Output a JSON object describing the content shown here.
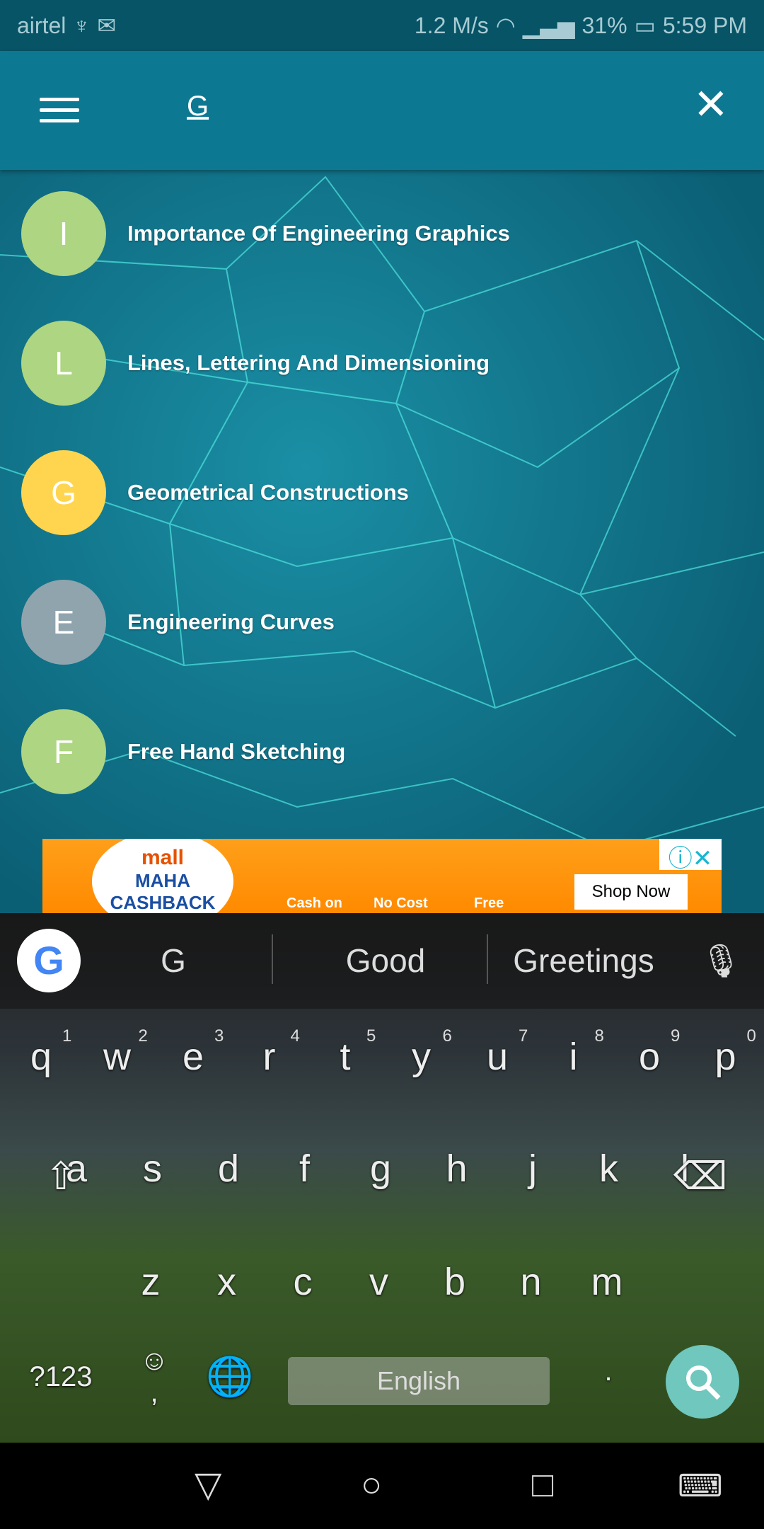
{
  "status": {
    "carrier": "airtel",
    "speed": "1.2 M/s",
    "battery": "31%",
    "time": "5:59 PM"
  },
  "search": {
    "query": "G"
  },
  "results": [
    {
      "letter": "I",
      "title": "Importance Of Engineering Graphics",
      "color": "#aed581"
    },
    {
      "letter": "L",
      "title": "Lines, Lettering And Dimensioning",
      "color": "#aed581"
    },
    {
      "letter": "G",
      "title": "Geometrical Constructions",
      "color": "#ffd54f"
    },
    {
      "letter": "E",
      "title": "Engineering Curves",
      "color": "#90a4ae"
    },
    {
      "letter": "F",
      "title": "Free Hand Sketching",
      "color": "#aed581"
    }
  ],
  "ad": {
    "brand": "mall",
    "headline": "MAHA CASHBACK",
    "features": [
      "Cash on",
      "No Cost",
      "Free"
    ],
    "cta": "Shop Now"
  },
  "keyboard": {
    "suggestions": [
      "G",
      "Good",
      "Greetings"
    ],
    "rows": [
      [
        "q",
        "w",
        "e",
        "r",
        "t",
        "y",
        "u",
        "i",
        "o",
        "p"
      ],
      [
        "a",
        "s",
        "d",
        "f",
        "g",
        "h",
        "j",
        "k",
        "l"
      ],
      [
        "z",
        "x",
        "c",
        "v",
        "b",
        "n",
        "m"
      ]
    ],
    "numbers": [
      "1",
      "2",
      "3",
      "4",
      "5",
      "6",
      "7",
      "8",
      "9",
      "0"
    ],
    "symbols_key": "?123",
    "comma": ",",
    "period": ".",
    "space_label": "English"
  }
}
